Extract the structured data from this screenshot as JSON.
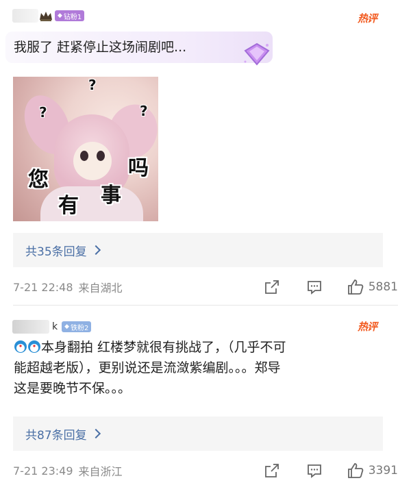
{
  "comments": [
    {
      "badge": "钻粉1",
      "hot": "热评",
      "text": "我服了 赶紧停止这场闹剧吧...",
      "meme": {
        "words": [
          "您",
          "有",
          "事",
          "吗"
        ],
        "q": "?"
      },
      "replies": "共35条回复",
      "time": "7-21 22:48",
      "location": "来自湖北",
      "likes": "5881"
    },
    {
      "username_suffix": "k",
      "badge": "铁粉2",
      "hot": "热评",
      "text_lines": [
        "本身翻拍 红楼梦就很有挑战了，（几乎不可",
        "能超越老版），更别说还是流潋紫编剧。。。郑导",
        "这是要晚节不保。。。"
      ],
      "replies": "共87条回复",
      "time": "7-21 23:49",
      "location": "来自浙江",
      "likes": "3391"
    }
  ],
  "icons": {
    "crown": "crown-icon",
    "gem": "diamond-gem-icon",
    "share": "share-icon",
    "comment": "comment-icon",
    "like": "thumbs-up-icon",
    "emoji": "doraemon-emoji-icon"
  },
  "colors": {
    "hot": "#f25a1f",
    "link": "#4a6fa5",
    "diamond_badge": "#b07ad9",
    "iron_badge": "#8fb1e3"
  }
}
